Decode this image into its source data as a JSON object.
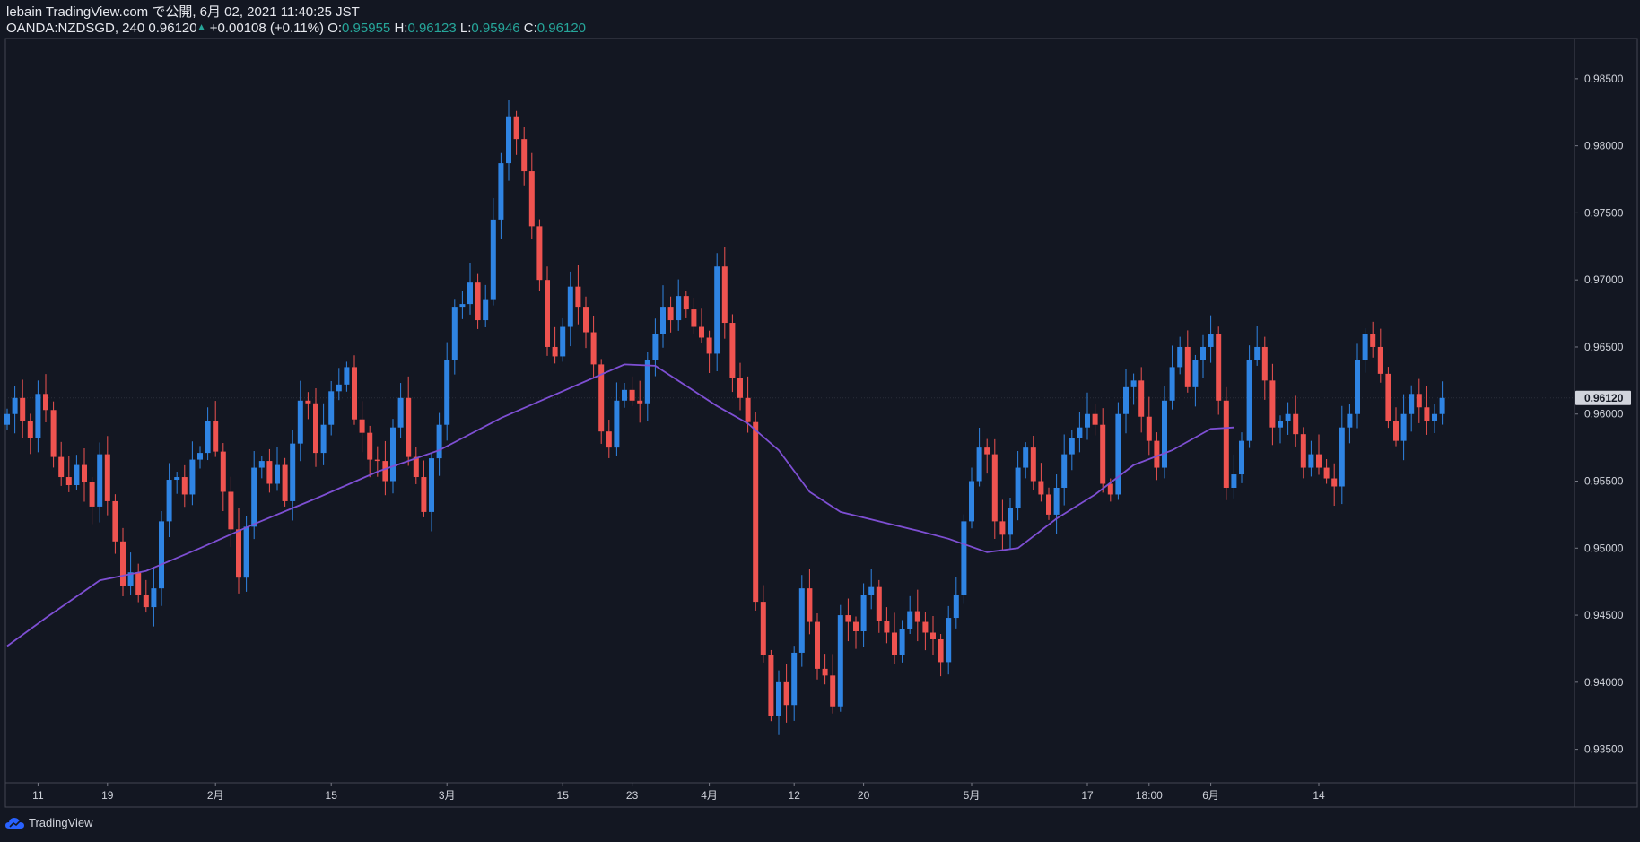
{
  "header": {
    "publisher": "lebain TradingView.com で公開, 6月 02, 2021 11:40:25 JST",
    "symbol": "OANDA:NZDSGD, 240",
    "last": "0.96120",
    "change_arrow": "▲",
    "change": "+0.00108 (+0.11%)",
    "open_label": "O:",
    "open": "0.95955",
    "high_label": "H:",
    "high": "0.96123",
    "low_label": "L:",
    "low": "0.95946",
    "close_label": "C:",
    "close": "0.96120"
  },
  "logo_text": "TradingView",
  "colors": {
    "background": "#131722",
    "up": "#2f84e3",
    "down": "#ef5350",
    "ma": "#7e4fd3",
    "price_badge": "#d1d4dc",
    "axis_text": "#d1d4dc"
  },
  "chart_data": {
    "type": "candlestick",
    "symbol": "OANDA:NZDSGD",
    "interval": "240",
    "ylim": [
      0.9325,
      0.988
    ],
    "y_ticks": [
      0.985,
      0.98,
      0.975,
      0.97,
      0.965,
      0.96,
      0.955,
      0.95,
      0.945,
      0.94,
      0.935
    ],
    "y_tick_labels": [
      "0.98500",
      "0.98000",
      "0.97500",
      "0.97000",
      "0.96500",
      "0.96000",
      "0.95500",
      "0.95000",
      "0.94500",
      "0.94000",
      "0.93500"
    ],
    "x_ticks": [
      {
        "label": "11",
        "index": 4
      },
      {
        "label": "19",
        "index": 13
      },
      {
        "label": "2月",
        "index": 27
      },
      {
        "label": "15",
        "index": 42
      },
      {
        "label": "3月",
        "index": 57
      },
      {
        "label": "15",
        "index": 72
      },
      {
        "label": "23",
        "index": 81
      },
      {
        "label": "4月",
        "index": 91
      },
      {
        "label": "12",
        "index": 102
      },
      {
        "label": "20",
        "index": 111
      },
      {
        "label": "5月",
        "index": 125
      },
      {
        "label": "17",
        "index": 140
      },
      {
        "label": "18:00",
        "index": 148
      },
      {
        "label": "6月",
        "index": 156
      },
      {
        "label": "14",
        "index": 170
      }
    ],
    "last_price": 0.9612,
    "last_price_label": "0.96120",
    "closes": [
      0.96,
      0.9612,
      0.9595,
      0.9582,
      0.9615,
      0.9603,
      0.9568,
      0.9553,
      0.9547,
      0.9562,
      0.9549,
      0.9531,
      0.957,
      0.9535,
      0.9505,
      0.9472,
      0.9482,
      0.9465,
      0.9456,
      0.947,
      0.952,
      0.9551,
      0.9553,
      0.954,
      0.9566,
      0.9571,
      0.9595,
      0.9572,
      0.9542,
      0.9514,
      0.9478,
      0.9516,
      0.956,
      0.9565,
      0.9548,
      0.9562,
      0.9535,
      0.9578,
      0.961,
      0.9608,
      0.9571,
      0.9592,
      0.9617,
      0.9622,
      0.9635,
      0.9596,
      0.9586,
      0.9566,
      0.9565,
      0.955,
      0.959,
      0.9612,
      0.9568,
      0.9553,
      0.9527,
      0.9567,
      0.9592,
      0.964,
      0.968,
      0.9682,
      0.9698,
      0.967,
      0.9685,
      0.9745,
      0.9787,
      0.9822,
      0.9805,
      0.9781,
      0.974,
      0.97,
      0.965,
      0.9643,
      0.9665,
      0.9695,
      0.968,
      0.9661,
      0.9637,
      0.9587,
      0.9575,
      0.961,
      0.9618,
      0.961,
      0.9608,
      0.964,
      0.966,
      0.968,
      0.967,
      0.9688,
      0.9678,
      0.9665,
      0.9657,
      0.9645,
      0.971,
      0.9668,
      0.9627,
      0.9612,
      0.9594,
      0.946,
      0.942,
      0.9375,
      0.94,
      0.9383,
      0.9422,
      0.947,
      0.9445,
      0.941,
      0.9405,
      0.9382,
      0.945,
      0.9445,
      0.9438,
      0.9465,
      0.9471,
      0.9446,
      0.9437,
      0.942,
      0.944,
      0.9453,
      0.9445,
      0.9437,
      0.9432,
      0.9415,
      0.9448,
      0.9465,
      0.952,
      0.955,
      0.9575,
      0.957,
      0.952,
      0.951,
      0.953,
      0.956,
      0.9575,
      0.955,
      0.954,
      0.9525,
      0.9545,
      0.957,
      0.9582,
      0.959,
      0.96,
      0.9592,
      0.9548,
      0.954,
      0.96,
      0.962,
      0.9625,
      0.9598,
      0.958,
      0.956,
      0.961,
      0.9635,
      0.965,
      0.962,
      0.964,
      0.965,
      0.966,
      0.961,
      0.9545,
      0.9555,
      0.958,
      0.964,
      0.965,
      0.9625,
      0.959,
      0.9595,
      0.96,
      0.9585,
      0.956,
      0.957,
      0.956,
      0.9552,
      0.9546,
      0.959,
      0.96,
      0.964,
      0.966,
      0.965,
      0.963,
      0.9595,
      0.958,
      0.96,
      0.9615,
      0.9605,
      0.9595,
      0.96,
      0.9612
    ],
    "moving_average": {
      "color": "#7e4fd3",
      "points": [
        [
          0,
          0.9427
        ],
        [
          5,
          0.9448
        ],
        [
          12,
          0.9476
        ],
        [
          18,
          0.9483
        ],
        [
          25,
          0.95
        ],
        [
          32,
          0.9518
        ],
        [
          40,
          0.9537
        ],
        [
          48,
          0.9557
        ],
        [
          56,
          0.9573
        ],
        [
          64,
          0.9597
        ],
        [
          72,
          0.9617
        ],
        [
          80,
          0.9637
        ],
        [
          84,
          0.9636
        ],
        [
          88,
          0.9621
        ],
        [
          92,
          0.9606
        ],
        [
          96,
          0.9593
        ],
        [
          100,
          0.9573
        ],
        [
          104,
          0.9542
        ],
        [
          108,
          0.9527
        ],
        [
          113,
          0.952
        ],
        [
          118,
          0.9513
        ],
        [
          122,
          0.9507
        ],
        [
          127,
          0.9497
        ],
        [
          131,
          0.95
        ],
        [
          136,
          0.9522
        ],
        [
          141,
          0.954
        ],
        [
          146,
          0.9562
        ],
        [
          151,
          0.9573
        ],
        [
          156,
          0.9589
        ],
        [
          159,
          0.959
        ]
      ]
    }
  }
}
